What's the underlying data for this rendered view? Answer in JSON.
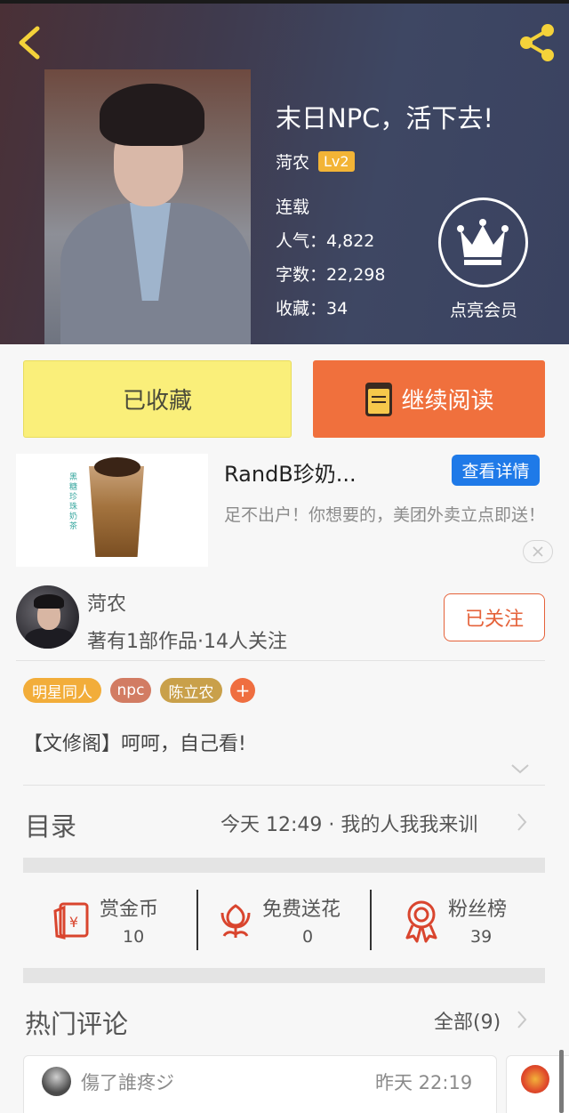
{
  "header": {
    "title": "末日NPC，活下去!",
    "author": "菏农",
    "level": "Lv2",
    "status": "连载",
    "popularity": "人气：4,822",
    "word_count": "字数：22,298",
    "favorites": "收藏：34",
    "vip_label": "点亮会员"
  },
  "actions": {
    "favorited_label": "已收藏",
    "continue_label": "继续阅读"
  },
  "ad": {
    "title": "RandB珍奶...",
    "detail_label": "查看详情",
    "description": "足不出户！你想要的，美团外卖立点即送！",
    "image_text": "黑糖珍珠奶茶"
  },
  "author_card": {
    "name": "菏农",
    "stats": "著有1部作品·14人关注",
    "follow_label": "已关注"
  },
  "tags": [
    "明星同人",
    "npc",
    "陈立农",
    "+"
  ],
  "intro": "【文修阁】呵呵，自己看!",
  "toc": {
    "title": "目录",
    "latest": "今天 12:49 · 我的人我我来训"
  },
  "stats": [
    {
      "label": "赏金币",
      "value": "10",
      "icon": "red-envelope-icon"
    },
    {
      "label": "免费送花",
      "value": "0",
      "icon": "flower-icon"
    },
    {
      "label": "粉丝榜",
      "value": "39",
      "icon": "medal-icon"
    }
  ],
  "comments": {
    "title": "热门评论",
    "all_label": "全部(9)",
    "items": [
      {
        "user": "傷了誰疼ジ",
        "time": "昨天 22:19"
      }
    ]
  },
  "colors": {
    "accent_orange": "#f0703d",
    "favorite_yellow": "#faef7a",
    "ad_blue": "#1f7ae8",
    "icon_red": "#d9452e"
  }
}
